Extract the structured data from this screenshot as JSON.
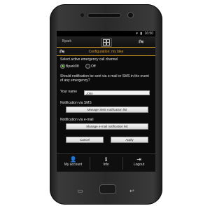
{
  "status": {
    "time": "16:50",
    "icons": "▾ ▮"
  },
  "appbar": {
    "title": "Bpark",
    "grid_icon": "grid-icon",
    "moto_icon": "motorcycle-icon"
  },
  "config": {
    "title": "Configuration: my bike",
    "moto_icon": "motorcycle-icon"
  },
  "channel": {
    "heading": "Select active emergency call channel",
    "options": [
      {
        "label": "Bpark08",
        "selected": true
      },
      {
        "label": "Off",
        "selected": false
      }
    ]
  },
  "notify": {
    "question": "Should notification be sent via e-mail or SMS in the event of any emergency?",
    "name_label": "Your name",
    "name_value": "John"
  },
  "sms": {
    "heading": "Notification via SMS",
    "button": "Manage SMS notification list"
  },
  "email": {
    "heading": "Notification via e-mail",
    "button": "Manage e-mail notification list"
  },
  "actions": {
    "cancel": "Cancel",
    "apply": "Apply"
  },
  "nav": {
    "items": [
      {
        "label": "My account",
        "icon": "account-icon"
      },
      {
        "label": "Info",
        "icon": "info-icon"
      },
      {
        "label": "Logout",
        "icon": "logout-icon"
      }
    ]
  },
  "colors": {
    "accent": "#c8901e",
    "radio_on": "#6ccf3a"
  }
}
